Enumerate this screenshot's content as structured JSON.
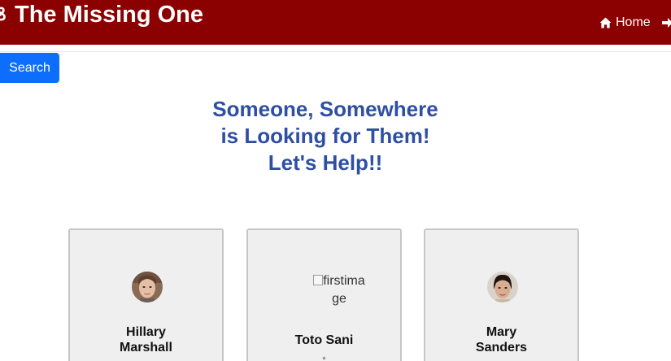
{
  "header": {
    "brand_icon": "ꝸ",
    "title": "The Missing One",
    "nav": {
      "home_label": "Home",
      "home_icon": "home-icon",
      "login_icon": "sign-in-arrow-icon"
    },
    "colors": {
      "navbar_bg": "#8b0000",
      "text": "#ffffff"
    }
  },
  "toolbar": {
    "search_label": "Search",
    "search_color": "#0d6efd"
  },
  "hero": {
    "line1": "Someone, Somewhere",
    "line2": "is Looking for Them!",
    "line3": "Let's Help!!",
    "color": "#2e4fa3"
  },
  "cards": [
    {
      "name_line1": "Hillary",
      "name_line2": "Marshall",
      "photo": "avatar-photo"
    },
    {
      "name": "Toto Sani",
      "image_alt": "firstimage",
      "sub_text": "*"
    },
    {
      "name_line1": "Mary",
      "name_line2": "Sanders",
      "photo": "avatar-photo"
    }
  ]
}
